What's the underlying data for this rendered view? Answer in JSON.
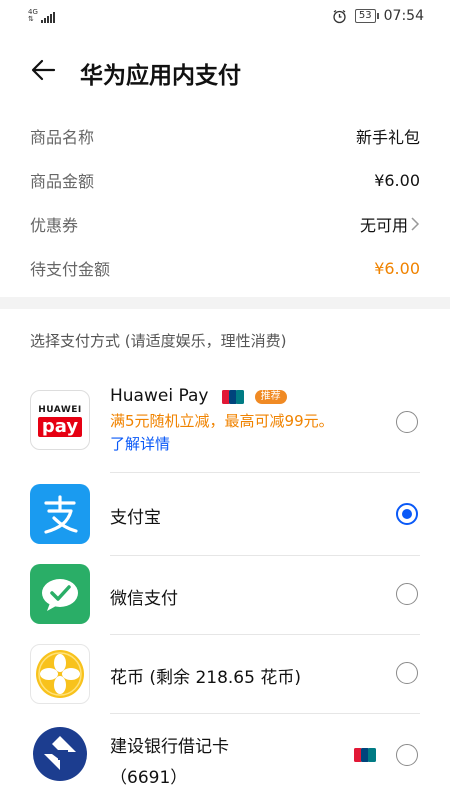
{
  "status_bar": {
    "network": "4G",
    "battery": "53",
    "time": "07:54"
  },
  "header": {
    "title": "华为应用内支付"
  },
  "details": {
    "product_name_label": "商品名称",
    "product_name_value": "新手礼包",
    "amount_label": "商品金额",
    "amount_value": "¥6.00",
    "coupon_label": "优惠券",
    "coupon_value": "无可用",
    "payable_label": "待支付金额",
    "payable_value": "¥6.00"
  },
  "section": {
    "title": "选择支付方式 (请适度娱乐，理性消费)"
  },
  "methods": [
    {
      "name": "Huawei Pay",
      "logo_text_top": "HUAWEI",
      "logo_text_bottom": "pay",
      "tag": "推荐",
      "promo": "满5元随机立减，最高可减99元。",
      "link": "了解详情",
      "selected": false
    },
    {
      "name": "支付宝",
      "logo_glyph": "支",
      "selected": true
    },
    {
      "name": "微信支付",
      "selected": false
    },
    {
      "name": "花币 (剩余 218.65 花币)",
      "selected": false
    },
    {
      "name_line1": "建设银行借记卡",
      "name_line2": "（6691）",
      "selected": false
    }
  ],
  "colors": {
    "accent": "#0a59f7",
    "orange": "#f08300",
    "alipay": "#1a9bf0",
    "wechat": "#2aae67",
    "ccb": "#1c3d8f"
  }
}
